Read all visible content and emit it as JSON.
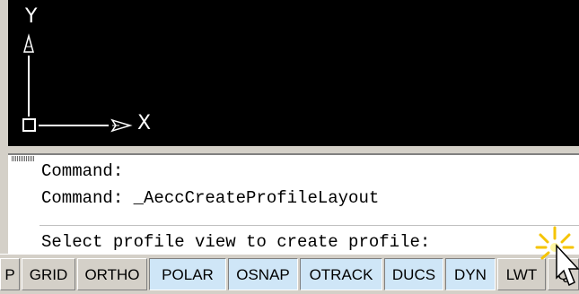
{
  "viewport": {
    "ucs_y_label": "Y",
    "ucs_x_label": "X"
  },
  "command": {
    "lines": [
      "Command:",
      "Command: _AeccCreateProfileLayout"
    ],
    "prompt": "Select profile view to create profile:"
  },
  "statusbar": {
    "buttons": [
      {
        "label": "P",
        "on": false
      },
      {
        "label": "GRID",
        "on": false
      },
      {
        "label": "ORTHO",
        "on": false
      },
      {
        "label": "POLAR",
        "on": true
      },
      {
        "label": "OSNAP",
        "on": true
      },
      {
        "label": "OTRACK",
        "on": true
      },
      {
        "label": "DUCS",
        "on": true
      },
      {
        "label": "DYN",
        "on": true
      },
      {
        "label": "LWT",
        "on": false
      },
      {
        "label": "Q",
        "on": false
      }
    ]
  },
  "colors": {
    "viewport_bg": "#000000",
    "toggle_on_bg": "#cfe6f7",
    "chrome_bg": "#d4d0c8"
  },
  "icons": [
    "ucs-icon",
    "mouse-pointer-icon",
    "click-burst-icon",
    "grip-icon"
  ]
}
